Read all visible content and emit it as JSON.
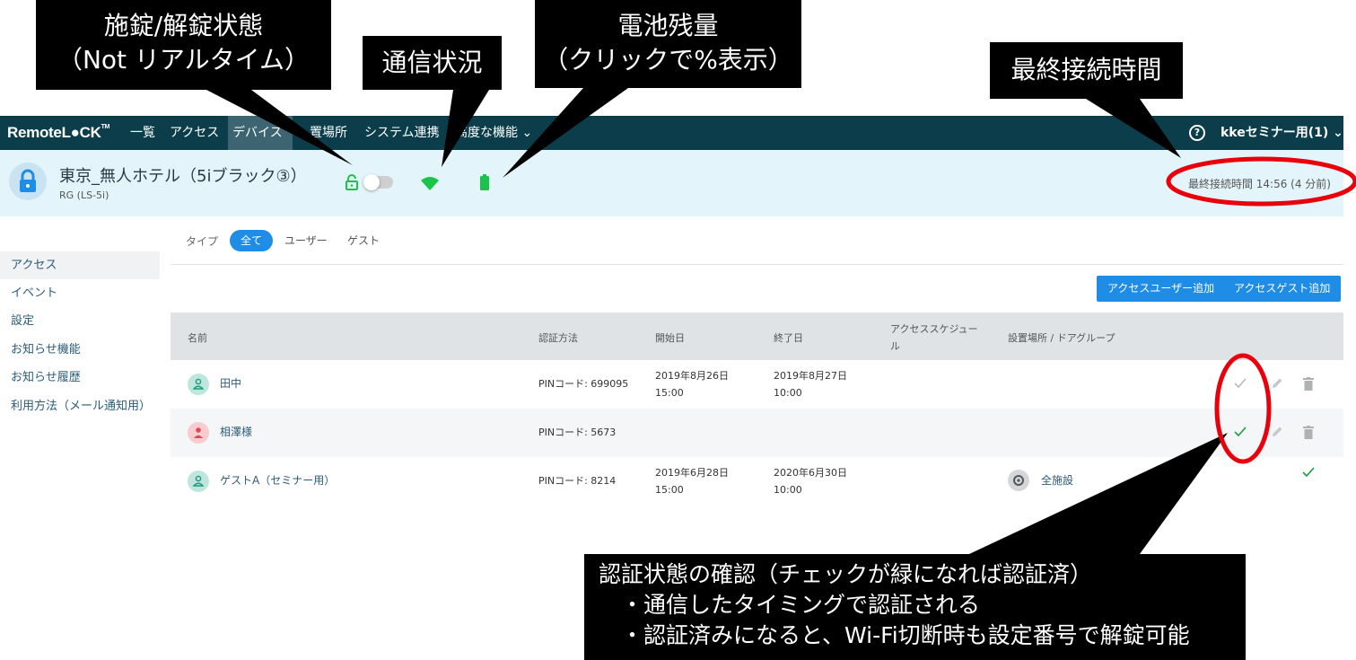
{
  "nav": {
    "logo_prefix": "Remote",
    "logo_lock": "L●CK",
    "logo_tm": "TM",
    "items": [
      {
        "label": "一覧"
      },
      {
        "label": "アクセス"
      },
      {
        "label": "デバイス"
      },
      {
        "label": "置場所"
      },
      {
        "label": "システム連携"
      },
      {
        "label": "高度な機能 ⌄"
      }
    ],
    "help": "?",
    "account": "kkeセミナー用(1) ⌄"
  },
  "device": {
    "title": "東京_無人ホテル（5iブラック③）",
    "model": "RG (LS-5i)",
    "last_connection": "最終接続時間 14:56 (4 分前)",
    "icons": [
      "lock-open-icon",
      "wifi-icon",
      "battery-icon"
    ],
    "status_color": "#1cc34b"
  },
  "sidebar": {
    "items": [
      {
        "label": "アクセス"
      },
      {
        "label": "イベント"
      },
      {
        "label": "設定"
      },
      {
        "label": "お知らせ機能"
      },
      {
        "label": "お知らせ履歴"
      },
      {
        "label": "利用方法（メール通知用）"
      }
    ]
  },
  "filter": {
    "label": "タイプ",
    "options": [
      {
        "label": "全て"
      },
      {
        "label": "ユーザー"
      },
      {
        "label": "ゲスト"
      }
    ]
  },
  "buttons": {
    "add_user": "アクセスユーザー追加",
    "add_guest": "アクセスゲスト追加"
  },
  "table": {
    "headers": {
      "name": "名前",
      "auth": "認証方法",
      "start": "開始日",
      "end": "終了日",
      "schedule_1": "アクセススケジュー",
      "schedule_2": "ル",
      "location": "設置場所 / ドアグループ"
    },
    "rows": [
      {
        "name": "田中",
        "auth": "PINコード: 699095",
        "start_date": "2019年8月26日",
        "start_time": "15:00",
        "end_date": "2019年8月27日",
        "end_time": "10:00",
        "location": "",
        "check": "gray"
      },
      {
        "name": "相澤様",
        "auth": "PINコード: 5673",
        "start_date": "",
        "start_time": "",
        "end_date": "",
        "end_time": "",
        "location": "",
        "check": "green"
      },
      {
        "name": "ゲストA（セミナー用）",
        "auth": "PINコード: 8214",
        "start_date": "2019年6月28日",
        "start_time": "15:00",
        "end_date": "2020年6月30日",
        "end_time": "10:00",
        "location": "全施設",
        "check": "green"
      }
    ]
  },
  "annotations": {
    "lock_state": [
      "施錠/解錠状態",
      "（Not リアルタイム）"
    ],
    "comm": "通信状況",
    "battery": [
      "電池残量",
      "（クリックで%表示）"
    ],
    "last_conn": "最終接続時間",
    "auth_check": [
      "認証状態の確認（チェックが緑になれば認証済）",
      "　・通信したタイミングで認証される",
      "　・認証済みになると、Wi-Fi切断時も設定番号で解錠可能"
    ]
  },
  "colors": {
    "nav_bg": "#0b3d4b",
    "accent": "#1f8ce6",
    "check_green": "#1a9a3c",
    "highlight_red": "#e8000b"
  }
}
